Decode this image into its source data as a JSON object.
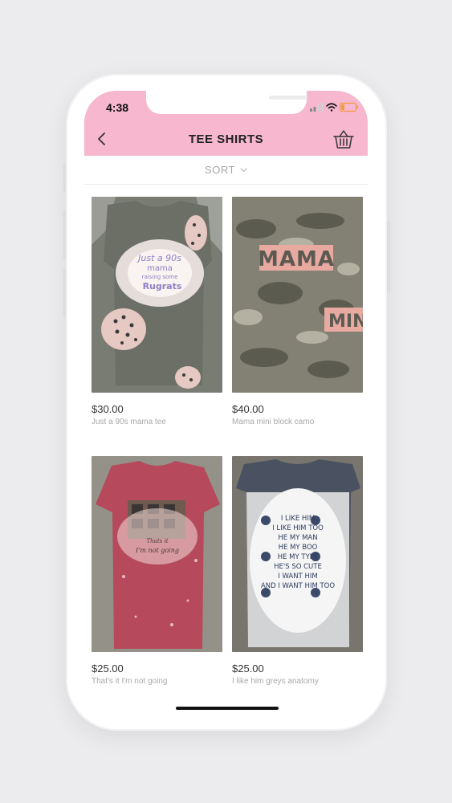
{
  "status_bar": {
    "time": "4:38"
  },
  "header": {
    "title": "TEE SHIRTS"
  },
  "sort": {
    "label": "SORT"
  },
  "products": [
    {
      "price": "$30.00",
      "name": "Just a 90s mama tee",
      "image": "gray-tee-leopard-print",
      "print_lines": [
        "Just a 90s",
        "mama",
        "raising some",
        "Rugrats"
      ]
    },
    {
      "price": "$40.00",
      "name": "Mama mini block camo",
      "image": "camo-tee-pink-block",
      "print_lines": [
        "MAMA",
        "MINI"
      ]
    },
    {
      "price": "$25.00",
      "name": "That's it I'm not going",
      "image": "red-bleached-tee",
      "print_lines": [
        "Thats it",
        "I'm not going"
      ]
    },
    {
      "price": "$25.00",
      "name": "I like him greys anatomy",
      "image": "greys-anatomy-tee",
      "print_lines": [
        "I LIKE HIM",
        "I LIKE HIM TOO",
        "HE MY MAN",
        "HE MY BOO",
        "HE MY TYPE",
        "HE'S SO CUTE",
        "I WANT HIM",
        "AND I WANT HIM TOO"
      ]
    }
  ],
  "colors": {
    "header_bg": "#f7b7cf",
    "page_bg": "#ececee",
    "price_text": "#333333",
    "name_text": "#a8a8ab"
  }
}
